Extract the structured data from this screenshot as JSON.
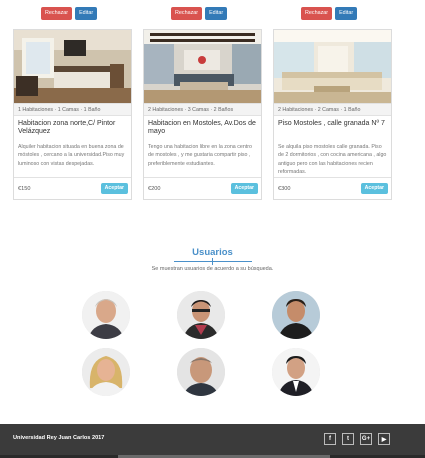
{
  "listings": [
    {
      "reject_label": "Rechazar",
      "edit_label": "Editar",
      "meta": "1 Habitaciones · 1 Camas · 1 Baño",
      "title": "Habitacion zona norte,C/ Pintor Velázquez",
      "description": "Alquiler habitacion situada en buena zona de móstoles , cercano a la universidad.Piso muy luminoso con vistas despejadas.",
      "price": "€150",
      "accept_label": "Aceptar"
    },
    {
      "reject_label": "Rechazar",
      "edit_label": "Editar",
      "meta": "2 Habitaciones · 3 Camas · 2 Baños",
      "title": "Habitacion en Mostoles, Av.Dos de mayo",
      "description": "Tengo una habitacion libre en la zona centro de mostoles , y me gustaria compartir piso , preferiblemente estudiantes.",
      "price": "€200",
      "accept_label": "Aceptar"
    },
    {
      "reject_label": "Rechazar",
      "edit_label": "Editar",
      "meta": "2 Habitaciones · 2 Camas · 1 Baño",
      "title": "Piso Mostoles , calle granada Nº 7",
      "description": "Se alquila piso mostoles calle granada. Piso de 2 dormitorios , con cocina americana , algo antiguo pero con las habitaciones recien reformadas.",
      "price": "€300",
      "accept_label": "Aceptar"
    }
  ],
  "users_section": {
    "title": "Usuarios",
    "subtitle": "Se muestran usuarios de acuerdo a su búsqueda."
  },
  "footer": {
    "copyright": "Universidad Rey Juan Carlos 2017",
    "social_icons": [
      "facebook-icon",
      "twitter-icon",
      "google-plus-icon",
      "youtube-icon"
    ],
    "social_glyphs": [
      "f",
      "t",
      "G+",
      "▶"
    ]
  },
  "colors": {
    "reject": "#d9534f",
    "edit": "#337ab7",
    "accept": "#5bc0de",
    "section_title": "#4a90c9",
    "footer_bg": "#3b3b3b"
  }
}
